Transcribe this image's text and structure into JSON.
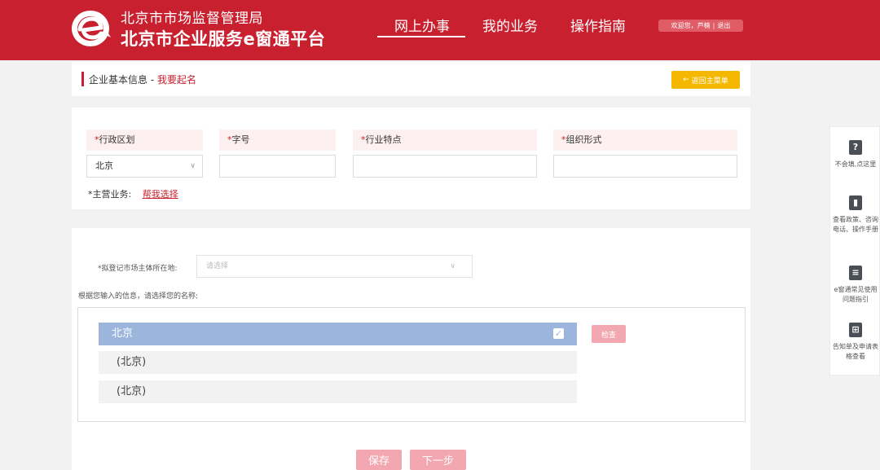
{
  "header": {
    "org_line1": "北京市市场监督管理局",
    "org_line2": "北京市企业服务e窗通平台",
    "nav": [
      "网上办事",
      "我的业务",
      "操作指南"
    ],
    "welcome": "欢迎您，芦楠",
    "logout": "退出",
    "brand_color": "#c8202f"
  },
  "title_bar": {
    "title": "企业基本信息 - ",
    "subtitle": "我要起名",
    "back_button": "返回主菜单"
  },
  "form": {
    "fields": [
      {
        "label": "行政区划",
        "value": "北京"
      },
      {
        "label": "字号",
        "value": ""
      },
      {
        "label": "行业特点",
        "value": ""
      },
      {
        "label": "组织形式",
        "value": ""
      }
    ],
    "main_business_label": "*主营业务:",
    "main_business_link": "帮我选择"
  },
  "section2": {
    "location_label": "*拟登记市场主体所在地:",
    "location_placeholder": "请选择",
    "hint": "根据您输入的信息，请选择您的名称:",
    "names": [
      {
        "text": "北京",
        "selected": true
      },
      {
        "text": "(北京)",
        "selected": false
      },
      {
        "text": "(北京)",
        "selected": false
      }
    ],
    "check_button": "检查",
    "save_button": "保存",
    "next_button": "下一步"
  },
  "side_panel": {
    "items": [
      {
        "icon": "question-icon",
        "label": "不会填,点这里"
      },
      {
        "icon": "book-icon",
        "label": "查看政策、咨询电话、操作手册"
      },
      {
        "icon": "list-icon",
        "label": "e窗通常见使用问题指引"
      },
      {
        "icon": "grid-icon",
        "label": "告知单及申请表格查看"
      }
    ]
  }
}
